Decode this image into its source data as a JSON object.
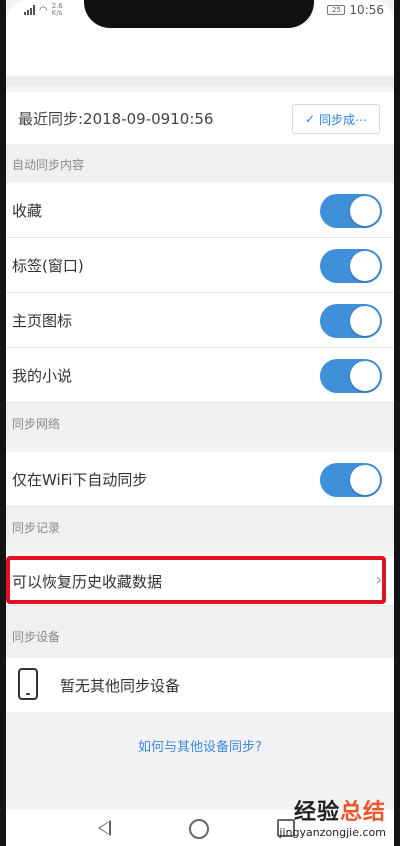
{
  "status_bar": {
    "network_speed": "2.6\nK/s",
    "battery": "25",
    "time": "10:56"
  },
  "sync": {
    "last_sync_text": "最近同步:2018-09-0910:56",
    "sync_button_label": "同步成⋯"
  },
  "sections": {
    "auto_sync_content": "自动同步内容",
    "sync_network": "同步网络",
    "sync_records": "同步记录",
    "sync_devices": "同步设备"
  },
  "auto_sync_items": [
    {
      "label": "收藏",
      "on": true
    },
    {
      "label": "标签(窗口)",
      "on": true
    },
    {
      "label": "主页图标",
      "on": true
    },
    {
      "label": "我的小说",
      "on": true
    }
  ],
  "network": {
    "wifi_only_label": "仅在WiFi下自动同步",
    "wifi_only_on": true
  },
  "records": {
    "restore_label": "可以恢复历史收藏数据"
  },
  "devices": {
    "no_devices_label": "暂无其他同步设备"
  },
  "howto_link": "如何与其他设备同步?",
  "watermark": {
    "main_a": "经验",
    "main_b": "总结",
    "sub": "jingyanzongjie.com"
  },
  "colors": {
    "toggle_on": "#3f8fd9",
    "link": "#3a88e0",
    "highlight": "#e0141f"
  },
  "icons": {
    "sync_button": "check-icon",
    "restore_row": "chevron-right-icon",
    "device": "phone-icon"
  }
}
